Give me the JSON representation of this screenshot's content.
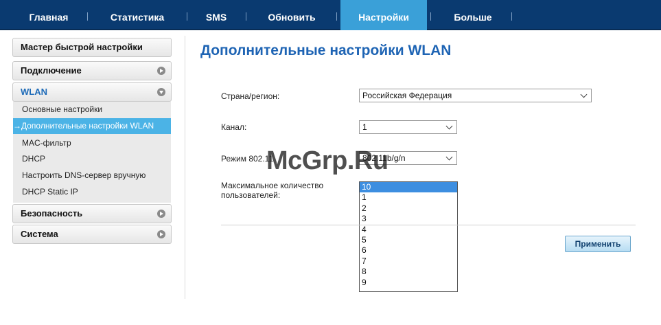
{
  "nav": {
    "tabs": [
      {
        "label": "Главная"
      },
      {
        "label": "Статистика"
      },
      {
        "label": "SMS"
      },
      {
        "label": "Обновить"
      },
      {
        "label": "Настройки",
        "active": true
      },
      {
        "label": "Больше"
      }
    ],
    "active_color": "#3aa0d8",
    "bar_color": "#0a3a70"
  },
  "sidebar": {
    "wizard_label": "Мастер быстрой настройки",
    "connection_label": "Подключение",
    "wlan_label": "WLAN",
    "wlan_items": [
      {
        "label": "Основные настройки"
      },
      {
        "label": "→Дополнительные настройки WLAN",
        "active": true
      },
      {
        "label": "MAC-фильтр"
      },
      {
        "label": "DHCP"
      },
      {
        "label": "Настроить DNS-сервер вручную"
      },
      {
        "label": "DHCP Static IP"
      }
    ],
    "security_label": "Безопасность",
    "system_label": "Система"
  },
  "main": {
    "title": "Дополнительные настройки WLAN",
    "country_label": "Страна/регион:",
    "country_value": "Российская Федерация",
    "channel_label": "Канал:",
    "channel_value": "1",
    "mode_label": "Режим 802.11",
    "mode_value": "802.11b/g/n",
    "max_users_label_line1": "Максимальное количество",
    "max_users_label_line2": "пользователей:",
    "max_users_options": [
      "10",
      "1",
      "2",
      "3",
      "4",
      "5",
      "6",
      "7",
      "8",
      "9"
    ],
    "max_users_selected": "10",
    "apply_label": "Применить"
  },
  "watermark": "McGrp.Ru"
}
